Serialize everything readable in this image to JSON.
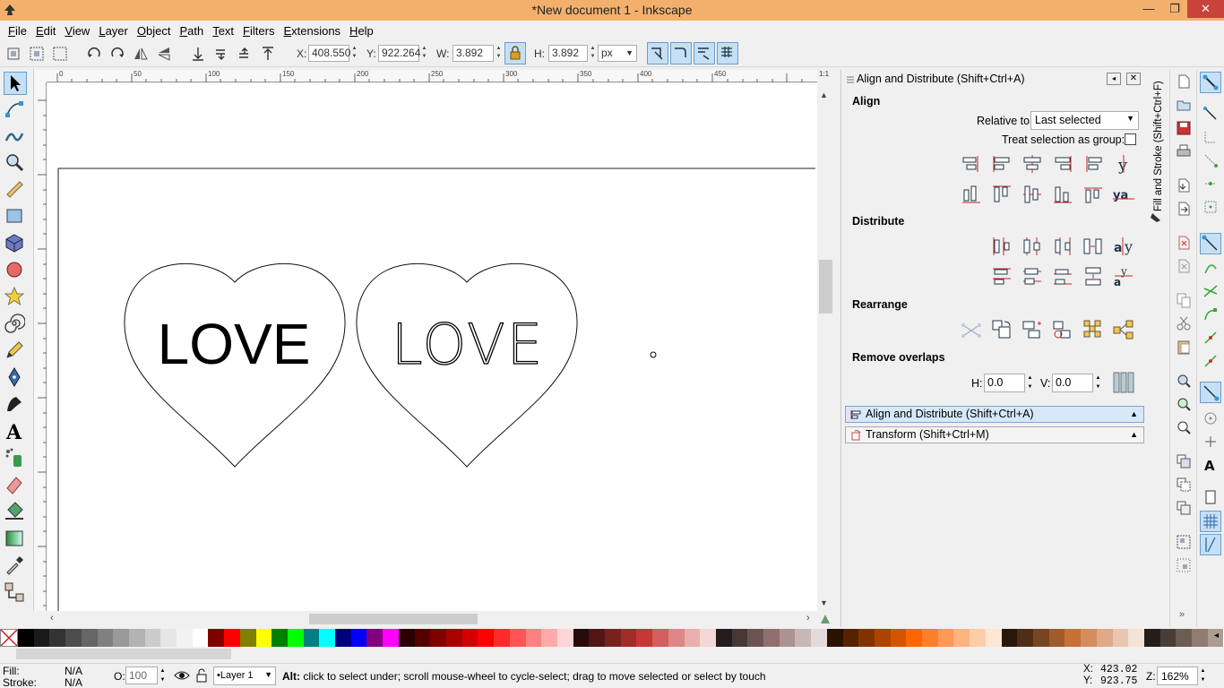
{
  "window": {
    "title": "*New document 1 - Inkscape",
    "min": "—",
    "max": "❐",
    "close": "✕"
  },
  "menu": [
    "File",
    "Edit",
    "View",
    "Layer",
    "Object",
    "Path",
    "Text",
    "Filters",
    "Extensions",
    "Help"
  ],
  "toolbar": {
    "x_label": "X:",
    "x_value": "408.550",
    "y_label": "Y:",
    "y_value": "922.264",
    "w_label": "W:",
    "w_value": "3.892",
    "h_label": "H:",
    "h_value": "3.892",
    "unit": "px"
  },
  "ruler_top": [
    "0",
    "50",
    "100",
    "150",
    "200",
    "250",
    "300",
    "350",
    "400",
    "450"
  ],
  "canvas": {
    "text_bold": "LOVE",
    "text_thin": "LOVE"
  },
  "panel": {
    "title": "Align and Distribute (Shift+Ctrl+A)",
    "align_heading": "Align",
    "relative_label": "Relative to:",
    "relative_value": "Last selected",
    "treat_group_label": "Treat selection as group:",
    "distribute_heading": "Distribute",
    "rearrange_heading": "Rearrange",
    "overlaps_heading": "Remove overlaps",
    "h_label": "H:",
    "h_value": "0.0",
    "v_label": "V:",
    "v_value": "0.0",
    "dialog_align": "Align and Distribute (Shift+Ctrl+A)",
    "dialog_transform": "Transform (Shift+Ctrl+M)",
    "side_tab": "Fill and Stroke (Shift+Ctrl+F)"
  },
  "palette": [
    "#000000",
    "#1a1a1a",
    "#333333",
    "#4d4d4d",
    "#666666",
    "#808080",
    "#999999",
    "#b3b3b3",
    "#cccccc",
    "#e6e6e6",
    "#f2f2f2",
    "#ffffff",
    "#800000",
    "#ff0000",
    "#808000",
    "#ffff00",
    "#008000",
    "#00ff00",
    "#008080",
    "#00ffff",
    "#000080",
    "#0000ff",
    "#800080",
    "#ff00ff",
    "#2b0000",
    "#550000",
    "#800000",
    "#aa0000",
    "#d40000",
    "#ff0000",
    "#ff2a2a",
    "#ff5555",
    "#ff8080",
    "#ffaaaa",
    "#ffd5d5",
    "#280b0b",
    "#501616",
    "#782121",
    "#a02c2c",
    "#c83737",
    "#d35f5f",
    "#de8787",
    "#e9afaf",
    "#f4d7d7",
    "#241c1c",
    "#483737",
    "#6c5353",
    "#916f6f",
    "#ac9393",
    "#c8b7b7",
    "#e3dbdb",
    "#2b1100",
    "#552200",
    "#803300",
    "#aa4400",
    "#d45500",
    "#ff6600",
    "#ff7f2a",
    "#ff9955",
    "#ffb380",
    "#ffccaa",
    "#ffe6d5",
    "#28170b",
    "#502d16",
    "#784421",
    "#a05a2c",
    "#c87137",
    "#d38d5f",
    "#deaa87",
    "#e9c6af",
    "#f4e3d7",
    "#241f1c",
    "#483e37",
    "#6c5d53",
    "#917c6f",
    "#ac9d93"
  ],
  "status": {
    "fill_label": "Fill:",
    "fill_value": "N/A",
    "stroke_label": "Stroke:",
    "stroke_value": "N/A",
    "opacity_label": "O:",
    "opacity_value": "100",
    "layer": "•Layer 1",
    "message_bold": "Alt:",
    "message": " click to select under; scroll mouse-wheel to cycle-select; drag to move selected or select by touch",
    "x_label": "X:",
    "x_value": "423.02",
    "y_label": "Y:",
    "y_value": "923.75",
    "zoom_label": "Z:",
    "zoom_value": "162%"
  }
}
